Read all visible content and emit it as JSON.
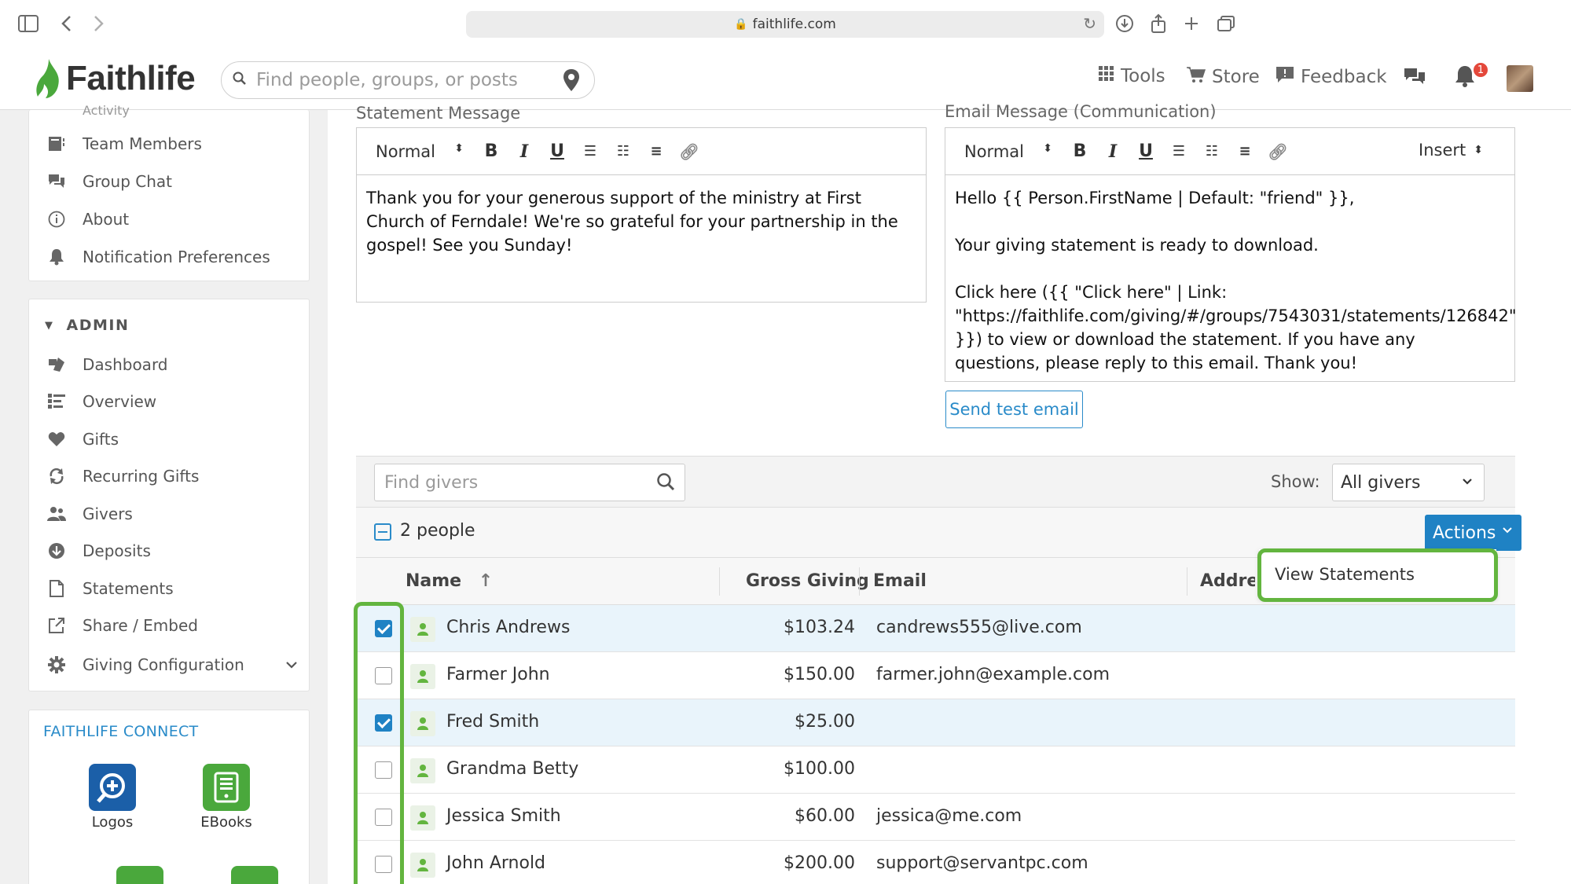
{
  "browser": {
    "url": "faithlife.com"
  },
  "header": {
    "logo_text": "Faithlife",
    "search_placeholder": "Find people, groups, or posts",
    "nav": [
      {
        "label": "Tools",
        "icon": "grid-icon"
      },
      {
        "label": "Store",
        "icon": "cart-icon"
      },
      {
        "label": "Feedback",
        "icon": "feedback-icon"
      }
    ],
    "notification_count": "1"
  },
  "sidebar": {
    "top_items": [
      {
        "label": "Activity",
        "icon": "activity-icon"
      },
      {
        "label": "Team Members",
        "icon": "team-members-icon"
      },
      {
        "label": "Group Chat",
        "icon": "chat-icon"
      },
      {
        "label": "About",
        "icon": "info-icon"
      },
      {
        "label": "Notification Preferences",
        "icon": "bell-icon"
      }
    ],
    "admin_title": "ADMIN",
    "admin_items": [
      {
        "label": "Dashboard",
        "icon": "dashboard-icon"
      },
      {
        "label": "Overview",
        "icon": "overview-icon"
      },
      {
        "label": "Gifts",
        "icon": "heart-icon"
      },
      {
        "label": "Recurring Gifts",
        "icon": "recurring-icon"
      },
      {
        "label": "Givers",
        "icon": "givers-icon"
      },
      {
        "label": "Deposits",
        "icon": "deposit-icon"
      },
      {
        "label": "Statements",
        "icon": "document-icon"
      },
      {
        "label": "Share / Embed",
        "icon": "share-icon"
      },
      {
        "label": "Giving Configuration",
        "icon": "gear-icon"
      }
    ],
    "connect_title": "FAITHLIFE CONNECT",
    "apps": [
      {
        "label": "Logos",
        "color": "#1b5fa8"
      },
      {
        "label": "EBooks",
        "color": "#4aa83c"
      }
    ]
  },
  "statement": {
    "label": "Statement Message",
    "format": "Normal",
    "body": "Thank you for your generous support of the ministry at First Church of Ferndale! We're so grateful for your partnership in the gospel! See you Sunday!"
  },
  "email": {
    "label": "Email Message (Communication)",
    "format": "Normal",
    "insert_label": "Insert",
    "line1": "Hello {{ Person.FirstName | Default: \"friend\" }},",
    "line2": "Your giving statement is ready to download.",
    "line3": "Click here ({{ \"Click here\" | Link: \"https://faithlife.com/giving/#/groups/7543031/statements/126842\" }}) to view or download the statement. If you have any questions, please reply to this email. Thank you!",
    "send_test_label": "Send test email"
  },
  "givers": {
    "search_placeholder": "Find givers",
    "show_label": "Show:",
    "show_value": "All givers",
    "count_text": "2 people",
    "actions_label": "Actions",
    "dropdown_item": "View Statements",
    "columns": {
      "name": "Name",
      "gross": "Gross Giving",
      "email": "Email",
      "address": "Address"
    },
    "rows": [
      {
        "name": "Chris Andrews",
        "gross": "$103.24",
        "email": "candrews555@live.com",
        "checked": true
      },
      {
        "name": "Farmer John",
        "gross": "$150.00",
        "email": "farmer.john@example.com",
        "checked": false
      },
      {
        "name": "Fred Smith",
        "gross": "$25.00",
        "email": "",
        "checked": true
      },
      {
        "name": "Grandma Betty",
        "gross": "$100.00",
        "email": "",
        "checked": false
      },
      {
        "name": "Jessica Smith",
        "gross": "$60.00",
        "email": "jessica@me.com",
        "checked": false
      },
      {
        "name": "John Arnold",
        "gross": "$200.00",
        "email": "support@servantpc.com",
        "checked": false
      }
    ]
  },
  "colors": {
    "accent": "#1f82c4",
    "highlight": "#63b53f",
    "logo_green": "#4aa83c"
  }
}
